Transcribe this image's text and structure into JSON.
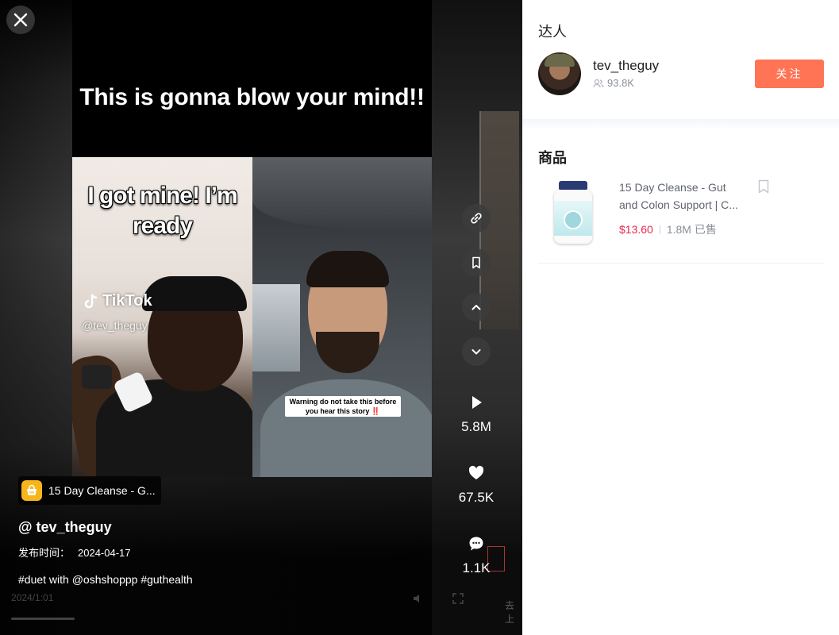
{
  "video": {
    "caption": "This is gonna blow your mind!!",
    "sticker_text": "I got mine! I’m ready",
    "watermark_brand": "TikTok",
    "watermark_handle": "@tev_theguy",
    "warning_label": "Warning do not take this before you hear this story ‼️"
  },
  "stats": {
    "plays": "5.8M",
    "likes": "67.5K",
    "comments": "1.1K"
  },
  "info": {
    "product_chip": "15 Day Cleanse - G...",
    "author": "@ tev_theguy",
    "publish_label": "发布时间：",
    "publish_date": "2024-04-17",
    "tags": "#duet with @oshshoppp #guthealth",
    "player_time": "2024/1:01",
    "tail_text": "去上"
  },
  "side": {
    "creator_section": "达人",
    "creator_name": "tev_theguy",
    "followers": "93.8K",
    "follow_label": "关注",
    "products_section": "商品",
    "product": {
      "title": "15 Day Cleanse - Gut and Colon Support | C...",
      "price": "$13.60",
      "sold": "1.8M 已售"
    }
  },
  "icons": [
    "close-icon",
    "link-icon",
    "bookmark-icon",
    "chevron-up-icon",
    "chevron-down-icon",
    "play-icon",
    "heart-icon",
    "comment-icon",
    "shopping-bag-icon",
    "followers-icon"
  ]
}
